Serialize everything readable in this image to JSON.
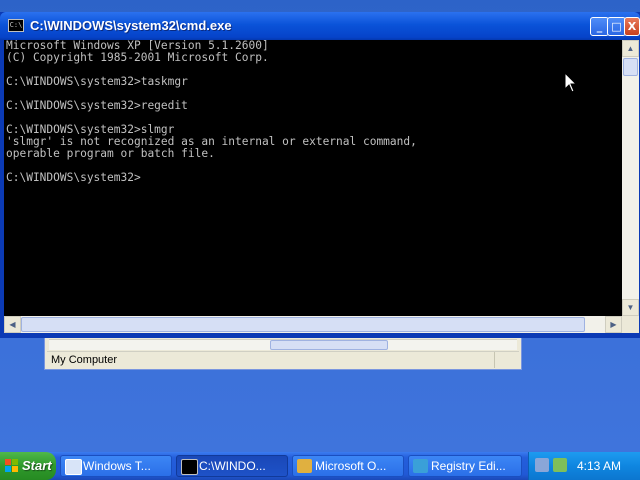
{
  "window": {
    "title": "C:\\WINDOWS\\system32\\cmd.exe",
    "icon": "cmd-icon",
    "controls": {
      "minimize": "_",
      "maximize": "□",
      "close": "X"
    }
  },
  "console": {
    "lines": [
      "Microsoft Windows XP [Version 5.1.2600]",
      "(C) Copyright 1985-2001 Microsoft Corp.",
      "",
      "C:\\WINDOWS\\system32>taskmgr",
      "",
      "C:\\WINDOWS\\system32>regedit",
      "",
      "C:\\WINDOWS\\system32>slmgr",
      "'slmgr' is not recognized as an internal or external command,",
      "operable program or batch file.",
      "",
      "C:\\WINDOWS\\system32>"
    ]
  },
  "background_window": {
    "status_text": "My Computer"
  },
  "taskbar": {
    "start_label": "Start",
    "tasks": [
      {
        "label": "Windows T...",
        "icon": "task-manager-icon",
        "active": false
      },
      {
        "label": "C:\\WINDO...",
        "icon": "cmd-icon",
        "active": true
      },
      {
        "label": "Microsoft O...",
        "icon": "office-icon",
        "active": false
      },
      {
        "label": "Registry Edi...",
        "icon": "regedit-icon",
        "active": false
      }
    ],
    "clock": "4:13 AM"
  }
}
